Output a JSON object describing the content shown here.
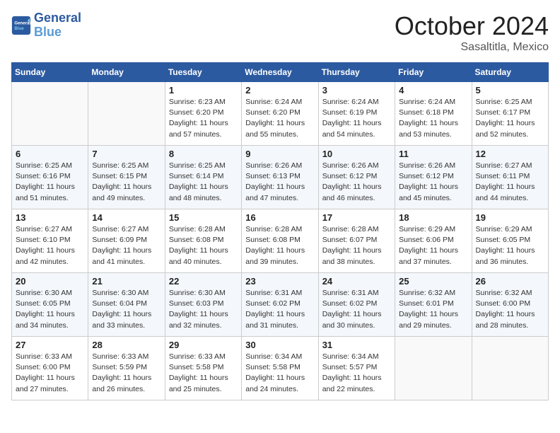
{
  "header": {
    "logo": {
      "line1": "General",
      "line2": "Blue"
    },
    "title": "October 2024",
    "location": "Sasaltitla, Mexico"
  },
  "weekdays": [
    "Sunday",
    "Monday",
    "Tuesday",
    "Wednesday",
    "Thursday",
    "Friday",
    "Saturday"
  ],
  "weeks": [
    [
      {
        "day": "",
        "info": ""
      },
      {
        "day": "",
        "info": ""
      },
      {
        "day": "1",
        "info": "Sunrise: 6:23 AM\nSunset: 6:20 PM\nDaylight: 11 hours and 57 minutes."
      },
      {
        "day": "2",
        "info": "Sunrise: 6:24 AM\nSunset: 6:20 PM\nDaylight: 11 hours and 55 minutes."
      },
      {
        "day": "3",
        "info": "Sunrise: 6:24 AM\nSunset: 6:19 PM\nDaylight: 11 hours and 54 minutes."
      },
      {
        "day": "4",
        "info": "Sunrise: 6:24 AM\nSunset: 6:18 PM\nDaylight: 11 hours and 53 minutes."
      },
      {
        "day": "5",
        "info": "Sunrise: 6:25 AM\nSunset: 6:17 PM\nDaylight: 11 hours and 52 minutes."
      }
    ],
    [
      {
        "day": "6",
        "info": "Sunrise: 6:25 AM\nSunset: 6:16 PM\nDaylight: 11 hours and 51 minutes."
      },
      {
        "day": "7",
        "info": "Sunrise: 6:25 AM\nSunset: 6:15 PM\nDaylight: 11 hours and 49 minutes."
      },
      {
        "day": "8",
        "info": "Sunrise: 6:25 AM\nSunset: 6:14 PM\nDaylight: 11 hours and 48 minutes."
      },
      {
        "day": "9",
        "info": "Sunrise: 6:26 AM\nSunset: 6:13 PM\nDaylight: 11 hours and 47 minutes."
      },
      {
        "day": "10",
        "info": "Sunrise: 6:26 AM\nSunset: 6:12 PM\nDaylight: 11 hours and 46 minutes."
      },
      {
        "day": "11",
        "info": "Sunrise: 6:26 AM\nSunset: 6:12 PM\nDaylight: 11 hours and 45 minutes."
      },
      {
        "day": "12",
        "info": "Sunrise: 6:27 AM\nSunset: 6:11 PM\nDaylight: 11 hours and 44 minutes."
      }
    ],
    [
      {
        "day": "13",
        "info": "Sunrise: 6:27 AM\nSunset: 6:10 PM\nDaylight: 11 hours and 42 minutes."
      },
      {
        "day": "14",
        "info": "Sunrise: 6:27 AM\nSunset: 6:09 PM\nDaylight: 11 hours and 41 minutes."
      },
      {
        "day": "15",
        "info": "Sunrise: 6:28 AM\nSunset: 6:08 PM\nDaylight: 11 hours and 40 minutes."
      },
      {
        "day": "16",
        "info": "Sunrise: 6:28 AM\nSunset: 6:08 PM\nDaylight: 11 hours and 39 minutes."
      },
      {
        "day": "17",
        "info": "Sunrise: 6:28 AM\nSunset: 6:07 PM\nDaylight: 11 hours and 38 minutes."
      },
      {
        "day": "18",
        "info": "Sunrise: 6:29 AM\nSunset: 6:06 PM\nDaylight: 11 hours and 37 minutes."
      },
      {
        "day": "19",
        "info": "Sunrise: 6:29 AM\nSunset: 6:05 PM\nDaylight: 11 hours and 36 minutes."
      }
    ],
    [
      {
        "day": "20",
        "info": "Sunrise: 6:30 AM\nSunset: 6:05 PM\nDaylight: 11 hours and 34 minutes."
      },
      {
        "day": "21",
        "info": "Sunrise: 6:30 AM\nSunset: 6:04 PM\nDaylight: 11 hours and 33 minutes."
      },
      {
        "day": "22",
        "info": "Sunrise: 6:30 AM\nSunset: 6:03 PM\nDaylight: 11 hours and 32 minutes."
      },
      {
        "day": "23",
        "info": "Sunrise: 6:31 AM\nSunset: 6:02 PM\nDaylight: 11 hours and 31 minutes."
      },
      {
        "day": "24",
        "info": "Sunrise: 6:31 AM\nSunset: 6:02 PM\nDaylight: 11 hours and 30 minutes."
      },
      {
        "day": "25",
        "info": "Sunrise: 6:32 AM\nSunset: 6:01 PM\nDaylight: 11 hours and 29 minutes."
      },
      {
        "day": "26",
        "info": "Sunrise: 6:32 AM\nSunset: 6:00 PM\nDaylight: 11 hours and 28 minutes."
      }
    ],
    [
      {
        "day": "27",
        "info": "Sunrise: 6:33 AM\nSunset: 6:00 PM\nDaylight: 11 hours and 27 minutes."
      },
      {
        "day": "28",
        "info": "Sunrise: 6:33 AM\nSunset: 5:59 PM\nDaylight: 11 hours and 26 minutes."
      },
      {
        "day": "29",
        "info": "Sunrise: 6:33 AM\nSunset: 5:58 PM\nDaylight: 11 hours and 25 minutes."
      },
      {
        "day": "30",
        "info": "Sunrise: 6:34 AM\nSunset: 5:58 PM\nDaylight: 11 hours and 24 minutes."
      },
      {
        "day": "31",
        "info": "Sunrise: 6:34 AM\nSunset: 5:57 PM\nDaylight: 11 hours and 22 minutes."
      },
      {
        "day": "",
        "info": ""
      },
      {
        "day": "",
        "info": ""
      }
    ]
  ]
}
